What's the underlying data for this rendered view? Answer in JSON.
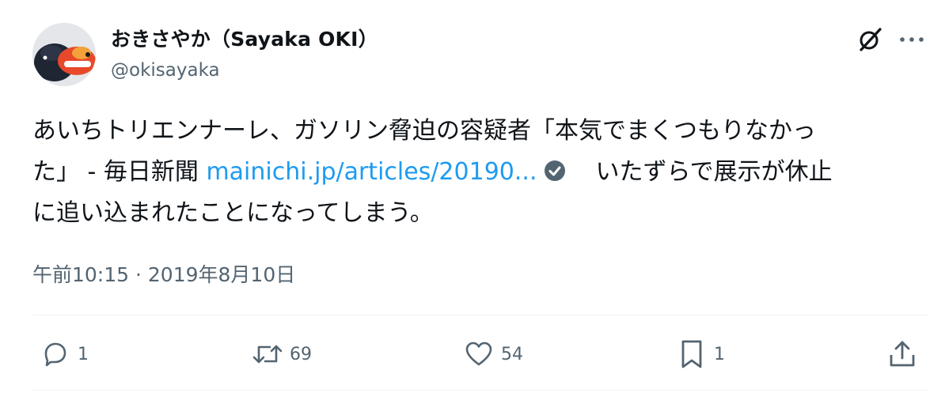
{
  "author": {
    "display_name": "おきさやか（Sayaka OKI）",
    "handle": "@okisayaka"
  },
  "icons": {
    "grok": "grok-slash-icon",
    "more": "more-dots-icon",
    "verified": "verified-check-icon",
    "reply": "reply-bubble-icon",
    "retweet": "retweet-icon",
    "like": "heart-icon",
    "bookmark": "bookmark-icon",
    "share": "share-upload-icon"
  },
  "tweet": {
    "line1": "あいちトリエンナーレ、ガソリン脅迫の容疑者「本気でまくつもりなかっ",
    "line2_prefix": "た」 - 毎日新聞 ",
    "link_text": "mainichi.jp/articles/20190...",
    "line2_suffix": "いたずらで展示が休止",
    "line3": "に追い込まれたことになってしまう。"
  },
  "timestamp": "午前10:15 · 2019年8月10日",
  "actions": {
    "reply_count": "1",
    "retweet_count": "69",
    "like_count": "54",
    "bookmark_count": "1"
  },
  "colors": {
    "text": "#0f1419",
    "secondary": "#536471",
    "link": "#1d9bf0",
    "divider": "#eff3f4",
    "verified_badge": "#536471"
  }
}
